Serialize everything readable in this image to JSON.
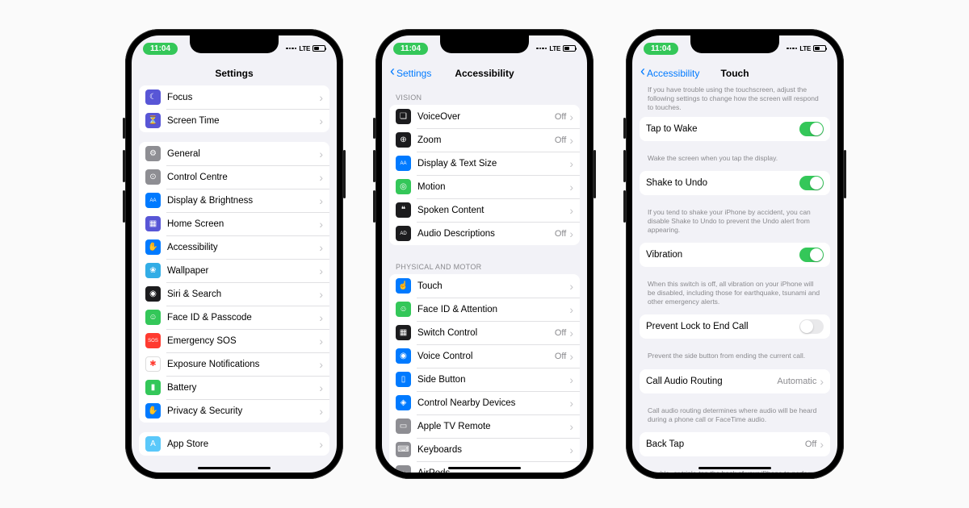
{
  "status": {
    "time": "11:04",
    "carrier": "LTE",
    "battery": "44"
  },
  "phone1": {
    "title": "Settings",
    "groups": [
      {
        "rows": [
          {
            "icon": "ic-purple",
            "glyph": "☾",
            "label": "Focus"
          },
          {
            "icon": "ic-purple",
            "glyph": "⏳",
            "label": "Screen Time"
          }
        ]
      },
      {
        "rows": [
          {
            "icon": "ic-gray",
            "glyph": "⚙",
            "label": "General"
          },
          {
            "icon": "ic-gray",
            "glyph": "⊙",
            "label": "Control Centre"
          },
          {
            "icon": "ic-blue",
            "glyph": "AA",
            "label": "Display & Brightness"
          },
          {
            "icon": "ic-indigo",
            "glyph": "▦",
            "label": "Home Screen"
          },
          {
            "icon": "ic-blue",
            "glyph": "✋",
            "label": "Accessibility"
          },
          {
            "icon": "ic-cyan",
            "glyph": "❀",
            "label": "Wallpaper"
          },
          {
            "icon": "ic-dark",
            "glyph": "◉",
            "label": "Siri & Search"
          },
          {
            "icon": "ic-green",
            "glyph": "☺",
            "label": "Face ID & Passcode"
          },
          {
            "icon": "ic-red",
            "glyph": "SOS",
            "label": "Emergency SOS"
          },
          {
            "icon": "ic-white",
            "glyph": "✱",
            "label": "Exposure Notifications"
          },
          {
            "icon": "ic-green",
            "glyph": "▮",
            "label": "Battery"
          },
          {
            "icon": "ic-blue",
            "glyph": "✋",
            "label": "Privacy & Security"
          }
        ]
      },
      {
        "rows": [
          {
            "icon": "ic-lblue",
            "glyph": "A",
            "label": "App Store"
          }
        ]
      }
    ]
  },
  "phone2": {
    "back": "Settings",
    "title": "Accessibility",
    "sections": [
      {
        "header": "VISION",
        "rows": [
          {
            "icon": "ic-dark",
            "glyph": "❏",
            "label": "VoiceOver",
            "value": "Off"
          },
          {
            "icon": "ic-dark",
            "glyph": "⊕",
            "label": "Zoom",
            "value": "Off"
          },
          {
            "icon": "ic-blue",
            "glyph": "AA",
            "label": "Display & Text Size"
          },
          {
            "icon": "ic-green",
            "glyph": "◎",
            "label": "Motion"
          },
          {
            "icon": "ic-dark",
            "glyph": "❝",
            "label": "Spoken Content"
          },
          {
            "icon": "ic-dark",
            "glyph": "AD",
            "label": "Audio Descriptions",
            "value": "Off"
          }
        ]
      },
      {
        "header": "PHYSICAL AND MOTOR",
        "rows": [
          {
            "icon": "ic-blue",
            "glyph": "☝",
            "label": "Touch"
          },
          {
            "icon": "ic-green",
            "glyph": "☺",
            "label": "Face ID & Attention"
          },
          {
            "icon": "ic-dark",
            "glyph": "▦",
            "label": "Switch Control",
            "value": "Off"
          },
          {
            "icon": "ic-blue",
            "glyph": "◉",
            "label": "Voice Control",
            "value": "Off"
          },
          {
            "icon": "ic-blue",
            "glyph": "▯",
            "label": "Side Button"
          },
          {
            "icon": "ic-blue",
            "glyph": "◈",
            "label": "Control Nearby Devices"
          },
          {
            "icon": "ic-gray",
            "glyph": "▭",
            "label": "Apple TV Remote"
          },
          {
            "icon": "ic-gray",
            "glyph": "⌨",
            "label": "Keyboards"
          },
          {
            "icon": "ic-gray",
            "glyph": "◦",
            "label": "AirPods"
          }
        ]
      }
    ]
  },
  "phone3": {
    "back": "Accessibility",
    "title": "Touch",
    "header_text": "If you have trouble using the touchscreen, adjust the following settings to change how the screen will respond to touches.",
    "items": [
      {
        "type": "toggle",
        "label": "Tap to Wake",
        "on": true,
        "footer": "Wake the screen when you tap the display."
      },
      {
        "type": "toggle",
        "label": "Shake to Undo",
        "on": true,
        "footer": "If you tend to shake your iPhone by accident, you can disable Shake to Undo to prevent the Undo alert from appearing."
      },
      {
        "type": "toggle",
        "label": "Vibration",
        "on": true,
        "footer": "When this switch is off, all vibration on your iPhone will be disabled, including those for earthquake, tsunami and other emergency alerts."
      },
      {
        "type": "toggle",
        "label": "Prevent Lock to End Call",
        "on": false,
        "footer": "Prevent the side button from ending the current call."
      },
      {
        "type": "link",
        "label": "Call Audio Routing",
        "value": "Automatic",
        "footer": "Call audio routing determines where audio will be heard during a phone call or FaceTime audio."
      },
      {
        "type": "link",
        "label": "Back Tap",
        "value": "Off",
        "footer": "Double- or triple-tap the back of your iPhone to perform actions quickly."
      }
    ]
  }
}
